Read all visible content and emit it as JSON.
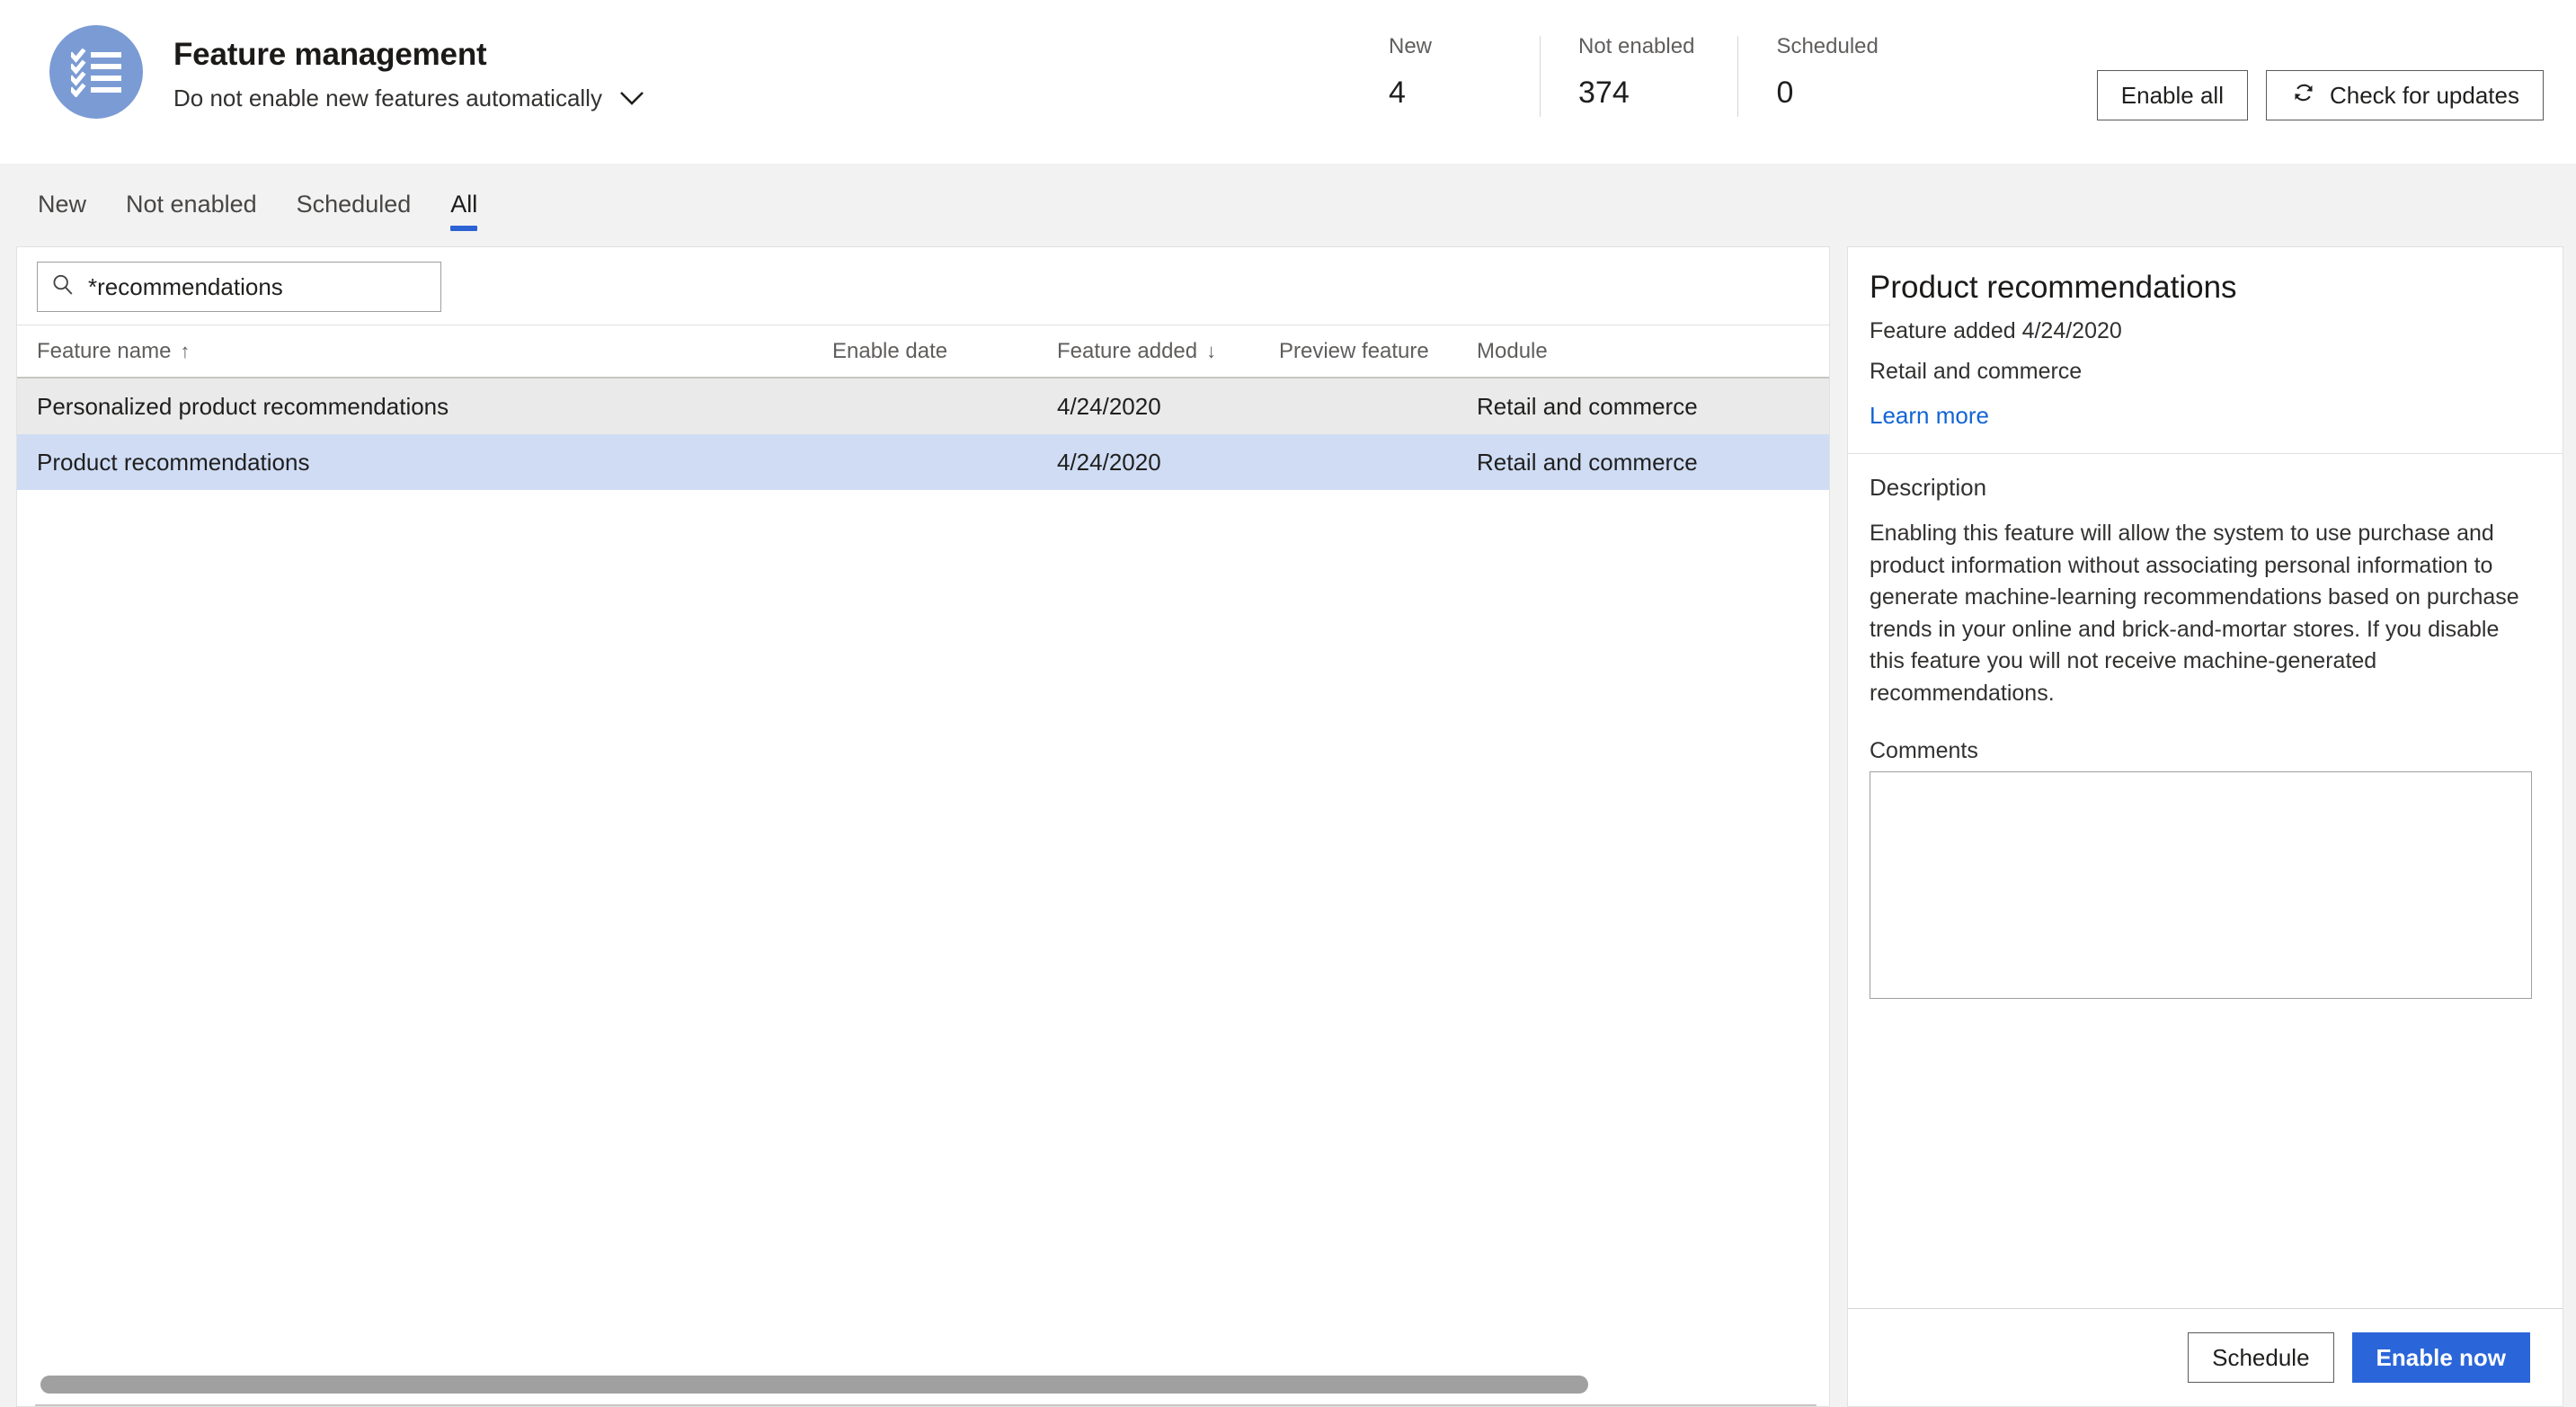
{
  "header": {
    "avatar_icon": "checklist-icon",
    "title": "Feature management",
    "subtitle": "Do not enable new features automatically",
    "chevron_icon": "chevron-down-icon",
    "stats": [
      {
        "label": "New",
        "value": "4"
      },
      {
        "label": "Not enabled",
        "value": "374"
      },
      {
        "label": "Scheduled",
        "value": "0"
      }
    ],
    "actions": {
      "enable_all": "Enable all",
      "check_updates": "Check for updates",
      "refresh_icon": "refresh-icon"
    }
  },
  "tabs": [
    {
      "label": "New",
      "active": false
    },
    {
      "label": "Not enabled",
      "active": false
    },
    {
      "label": "Scheduled",
      "active": false
    },
    {
      "label": "All",
      "active": true
    }
  ],
  "list": {
    "search": {
      "icon": "search-icon",
      "value": "*recommendations",
      "placeholder": "Filter"
    },
    "columns": [
      {
        "label": "Feature name",
        "sort": "↑"
      },
      {
        "label": "Enable date",
        "sort": ""
      },
      {
        "label": "Feature added",
        "sort": "↓"
      },
      {
        "label": "Preview feature",
        "sort": ""
      },
      {
        "label": "Module",
        "sort": ""
      }
    ],
    "rows": [
      {
        "name": "Personalized product recommendations",
        "enable_date": "",
        "feature_added": "4/24/2020",
        "preview_feature": "",
        "module": "Retail and commerce",
        "state": "hovered"
      },
      {
        "name": "Product recommendations",
        "enable_date": "",
        "feature_added": "4/24/2020",
        "preview_feature": "",
        "module": "Retail and commerce",
        "state": "selected"
      }
    ]
  },
  "detail": {
    "title": "Product recommendations",
    "added": "Feature added 4/24/2020",
    "module": "Retail and commerce",
    "learn_more": "Learn more",
    "description_label": "Description",
    "description": "Enabling this feature will allow the system to use purchase and product information without associating personal information to generate machine-learning recommendations based on purchase trends in your online and brick-and-mortar stores. If you disable this feature you will not receive machine-generated recommendations.",
    "comments_label": "Comments",
    "comments_value": "",
    "schedule_label": "Schedule",
    "enable_now_label": "Enable now"
  },
  "colors": {
    "accent": "#2a66d9",
    "avatar": "#7b9bd4",
    "link": "#1264d4",
    "row_selected": "#cfdcf4",
    "row_hover": "#eaeaea",
    "page_bg": "#f2f2f2"
  }
}
